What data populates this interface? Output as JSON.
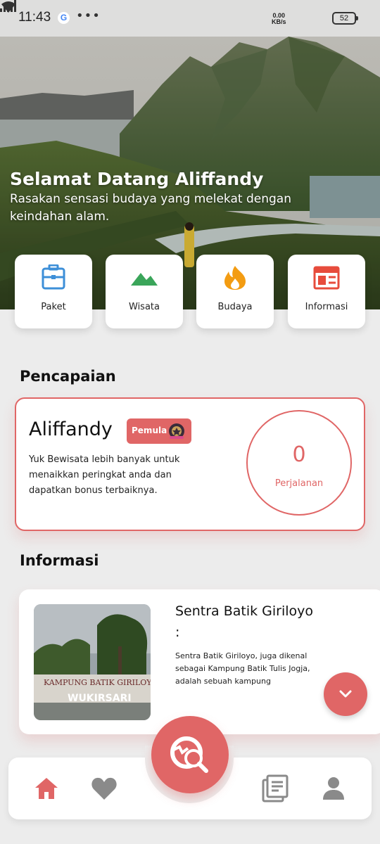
{
  "status": {
    "time": "11:43",
    "google_icon": "G",
    "more_dots": "•••",
    "net_speed_value": "0.00",
    "net_speed_unit": "KB/s",
    "battery": "52"
  },
  "hero": {
    "title": "Selamat Datang Aliffandy",
    "subtitle": "Rasakan sensasi budaya yang melekat dengan keindahan alam."
  },
  "categories": [
    {
      "label": "Paket",
      "icon": "briefcase-icon",
      "color": "#3d8fd8"
    },
    {
      "label": "Wisata",
      "icon": "mountain-icon",
      "color": "#3aa55a"
    },
    {
      "label": "Budaya",
      "icon": "fire-icon",
      "color": "#f39c12"
    },
    {
      "label": "Informasi",
      "icon": "newspaper-icon",
      "color": "#e74c3c"
    }
  ],
  "achievement": {
    "heading": "Pencapaian",
    "name": "Aliffandy",
    "badge": "Pemula",
    "description": "Yuk Bewisata lebih banyak untuk menaikkan peringkat anda dan dapatkan bonus terbaiknya.",
    "trip_count": "0",
    "trip_label": "Perjalanan"
  },
  "info": {
    "heading": "Informasi",
    "title": "Sentra Batik Giriloyo :",
    "body": "Sentra Batik Giriloyo, juga dikenal sebagai Kampung Batik Tulis Jogja, adalah sebuah kampung",
    "image_sign": "KAMPUNG BATIK GIRILOYO",
    "image_sign2": "WUKIRSARI"
  },
  "nav": {
    "items": [
      "home-icon",
      "heart-icon",
      "explore-search-icon",
      "news-icon",
      "profile-icon"
    ],
    "active_color": "#e06666",
    "inactive_color": "#8a8a8a"
  },
  "colors": {
    "accent": "#e06666",
    "background": "#ececec"
  }
}
